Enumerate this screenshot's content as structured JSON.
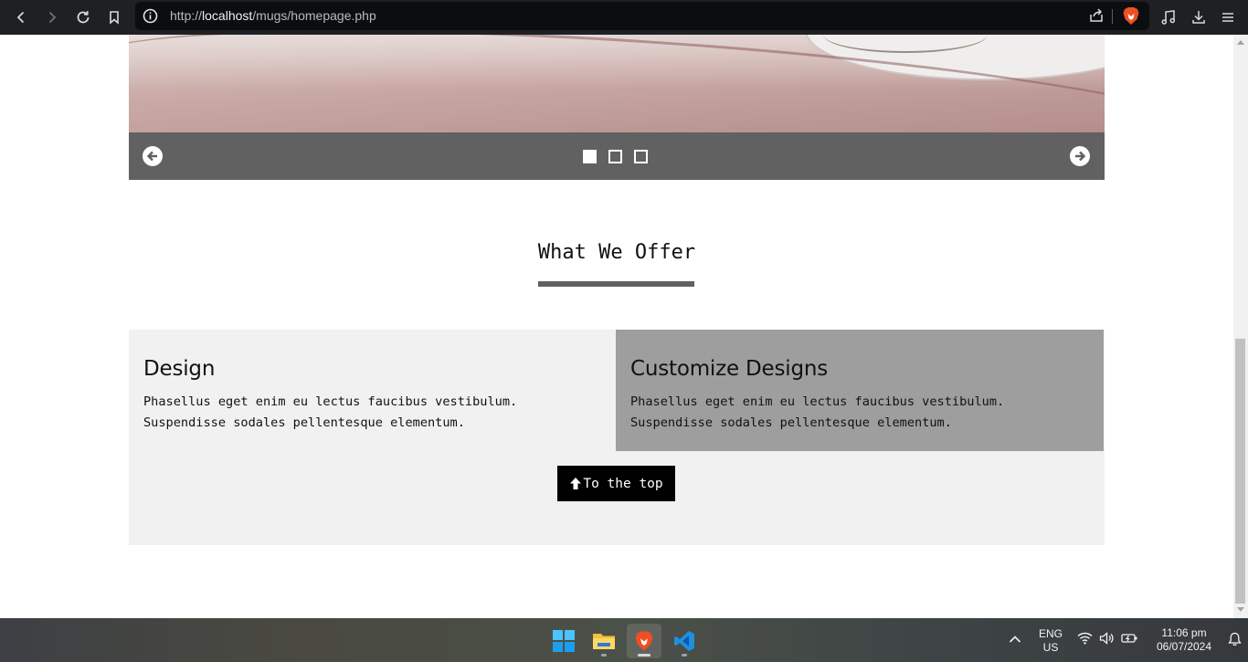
{
  "browser": {
    "url_prefix": "http://",
    "url_host": "localhost",
    "url_path": "/mugs/homepage.php"
  },
  "carousel": {
    "dots": [
      {
        "active": true
      },
      {
        "active": false
      },
      {
        "active": false
      }
    ]
  },
  "offer": {
    "title": "What We Offer",
    "cards": [
      {
        "heading": "Design",
        "line1": "Phasellus eget enim eu lectus faucibus vestibulum.",
        "line2": "Suspendisse sodales pellentesque elementum."
      },
      {
        "heading": "Customize Designs",
        "line1": "Phasellus eget enim eu lectus faucibus vestibulum.",
        "line2": "Suspendisse sodales pellentesque elementum."
      }
    ],
    "top_button_label": "To the top"
  },
  "taskbar": {
    "lang_line1": "ENG",
    "lang_line2": "US",
    "time": "11:06 pm",
    "date": "06/07/2024"
  },
  "colors": {
    "toolbar_bg": "#1f2024",
    "slider_bar": "#616161",
    "card_left": "#f1f1f1",
    "card_right": "#9e9e9e",
    "button_bg": "#000000"
  }
}
